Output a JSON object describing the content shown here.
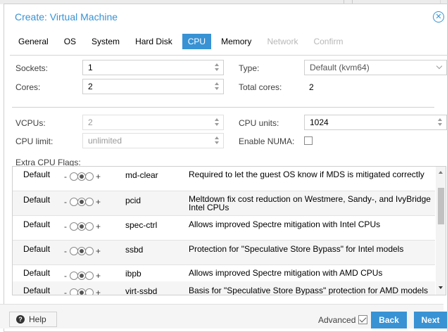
{
  "window": {
    "title": "Create: Virtual Machine",
    "close_icon": "circle-x-icon"
  },
  "tabs": [
    {
      "label": "General",
      "state": "normal"
    },
    {
      "label": "OS",
      "state": "normal"
    },
    {
      "label": "System",
      "state": "normal"
    },
    {
      "label": "Hard Disk",
      "state": "normal"
    },
    {
      "label": "CPU",
      "state": "active"
    },
    {
      "label": "Memory",
      "state": "normal"
    },
    {
      "label": "Network",
      "state": "disabled"
    },
    {
      "label": "Confirm",
      "state": "disabled"
    }
  ],
  "form": {
    "sockets_label": "Sockets:",
    "sockets_value": "1",
    "cores_label": "Cores:",
    "cores_value": "2",
    "type_label": "Type:",
    "type_value": "Default (kvm64)",
    "total_cores_label": "Total cores:",
    "total_cores_value": "2",
    "vcpus_label": "VCPUs:",
    "vcpus_value": "2",
    "cpu_units_label": "CPU units:",
    "cpu_units_value": "1024",
    "cpu_limit_label": "CPU limit:",
    "cpu_limit_value": "unlimited",
    "enable_numa_label": "Enable NUMA:",
    "enable_numa_checked": false
  },
  "flags": {
    "header": "Extra CPU Flags:",
    "minus": "-",
    "plus": "+",
    "rows": [
      {
        "state": "Default",
        "name": "md-clear",
        "description": "Required to let the guest OS know if MDS is mitigated correctly"
      },
      {
        "state": "Default",
        "name": "pcid",
        "description": "Meltdown fix cost reduction on Westmere, Sandy-, and IvyBridge Intel CPUs"
      },
      {
        "state": "Default",
        "name": "spec-ctrl",
        "description": "Allows improved Spectre mitigation with Intel CPUs"
      },
      {
        "state": "Default",
        "name": "ssbd",
        "description": "Protection for \"Speculative Store Bypass\" for Intel models"
      },
      {
        "state": "Default",
        "name": "ibpb",
        "description": "Allows improved Spectre mitigation with AMD CPUs"
      },
      {
        "state": "Default",
        "name": "virt-ssbd",
        "description": "Basis for \"Speculative Store Bypass\" protection for AMD models"
      }
    ]
  },
  "footer": {
    "help_label": "Help",
    "advanced_label": "Advanced",
    "advanced_checked": true,
    "back_label": "Back",
    "next_label": "Next"
  },
  "colors": {
    "accent": "#3892d4"
  }
}
